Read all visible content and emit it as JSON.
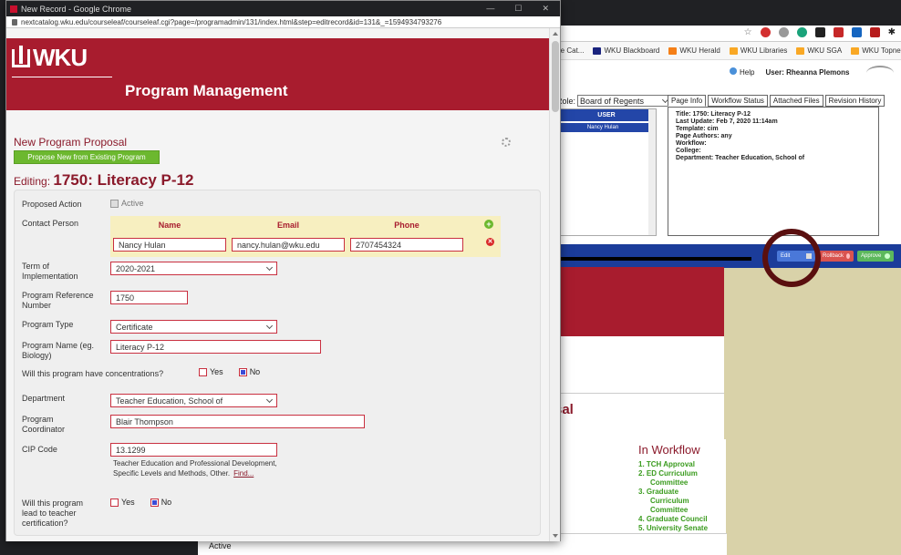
{
  "popup": {
    "window_title": "New Record - Google Chrome",
    "url": "nextcatalog.wku.edu/courseleaf/courseleaf.cgi?page=/programadmin/131/index.html&step=editrecord&id=131&_=1594934793276",
    "logo_text": "WKU",
    "banner_title": "Program Management",
    "proposal_title": "New Program Proposal",
    "propose_button": "Propose New from Existing Program",
    "editing_prefix": "Editing:",
    "editing_title": "1750: Literacy P-12",
    "form": {
      "proposed_action_label": "Proposed Action",
      "proposed_action_value": "Active",
      "contact_person_label": "Contact Person",
      "contact_headers": [
        "Name",
        "Email",
        "Phone"
      ],
      "contact_name": "Nancy Hulan",
      "contact_email": "nancy.hulan@wku.edu",
      "contact_phone": "2707454324",
      "term_label": "Term of Implementation",
      "term_value": "2020-2021",
      "ref_label": "Program Reference Number",
      "ref_value": "1750",
      "type_label": "Program Type",
      "type_value": "Certificate",
      "name_label": "Program Name (eg. Biology)",
      "name_value": "Literacy P-12",
      "conc_label": "Will this program have concentrations?",
      "yes": "Yes",
      "no": "No",
      "dept_label": "Department",
      "dept_value": "Teacher Education, School of",
      "coord_label": "Program Coordinator",
      "coord_value": "Blair Thompson",
      "cip_label": "CIP Code",
      "cip_value": "13.1299",
      "cip_desc": "Teacher Education and Professional Development, Specific Levels and Methods, Other.",
      "find_link": "Find...",
      "teacher_cert_label": "Will this program lead to teacher certification?"
    }
  },
  "background": {
    "bookmarks": [
      "ate Cat...",
      "WKU Blackboard",
      "WKU Herald",
      "WKU Libraries",
      "WKU SGA",
      "WKU Topnet"
    ],
    "help_label": "Help",
    "user_label": "User: Rheanna Plemons",
    "role_label": "Role:",
    "role_value": "Board of Regents",
    "user_header": "USER",
    "user_name": "Nancy Hulan",
    "tabs": [
      "Page Info",
      "Workflow Status",
      "Attached Files",
      "Revision History"
    ],
    "info": {
      "title": "Title: 1750: Literacy P-12",
      "last_update": "Last Update: Feb 7, 2020 11:14am",
      "template": "Template: cim",
      "authors": "Page Authors: any",
      "workflow": "Workflow:",
      "college": "College:",
      "department": "Department: Teacher Education, School of"
    },
    "buttons": {
      "edit": "Edit",
      "rollback": "Rollback",
      "approve": "Approve"
    },
    "partial_heading": "sal",
    "workflow_title": "In Workflow",
    "workflow_items": [
      "1. TCH Approval",
      "2. ED Curriculum",
      "Committee",
      "3. Graduate",
      "Curriculum",
      "Committee",
      "4. Graduate Council",
      "5. University Senate"
    ],
    "bottom_text": "Active"
  },
  "colors": {
    "wku_red": "#a81c2e",
    "green": "#6cb82f",
    "blue_bar": "#1b3c9a",
    "annotation_circle": "#5a0f0f"
  }
}
